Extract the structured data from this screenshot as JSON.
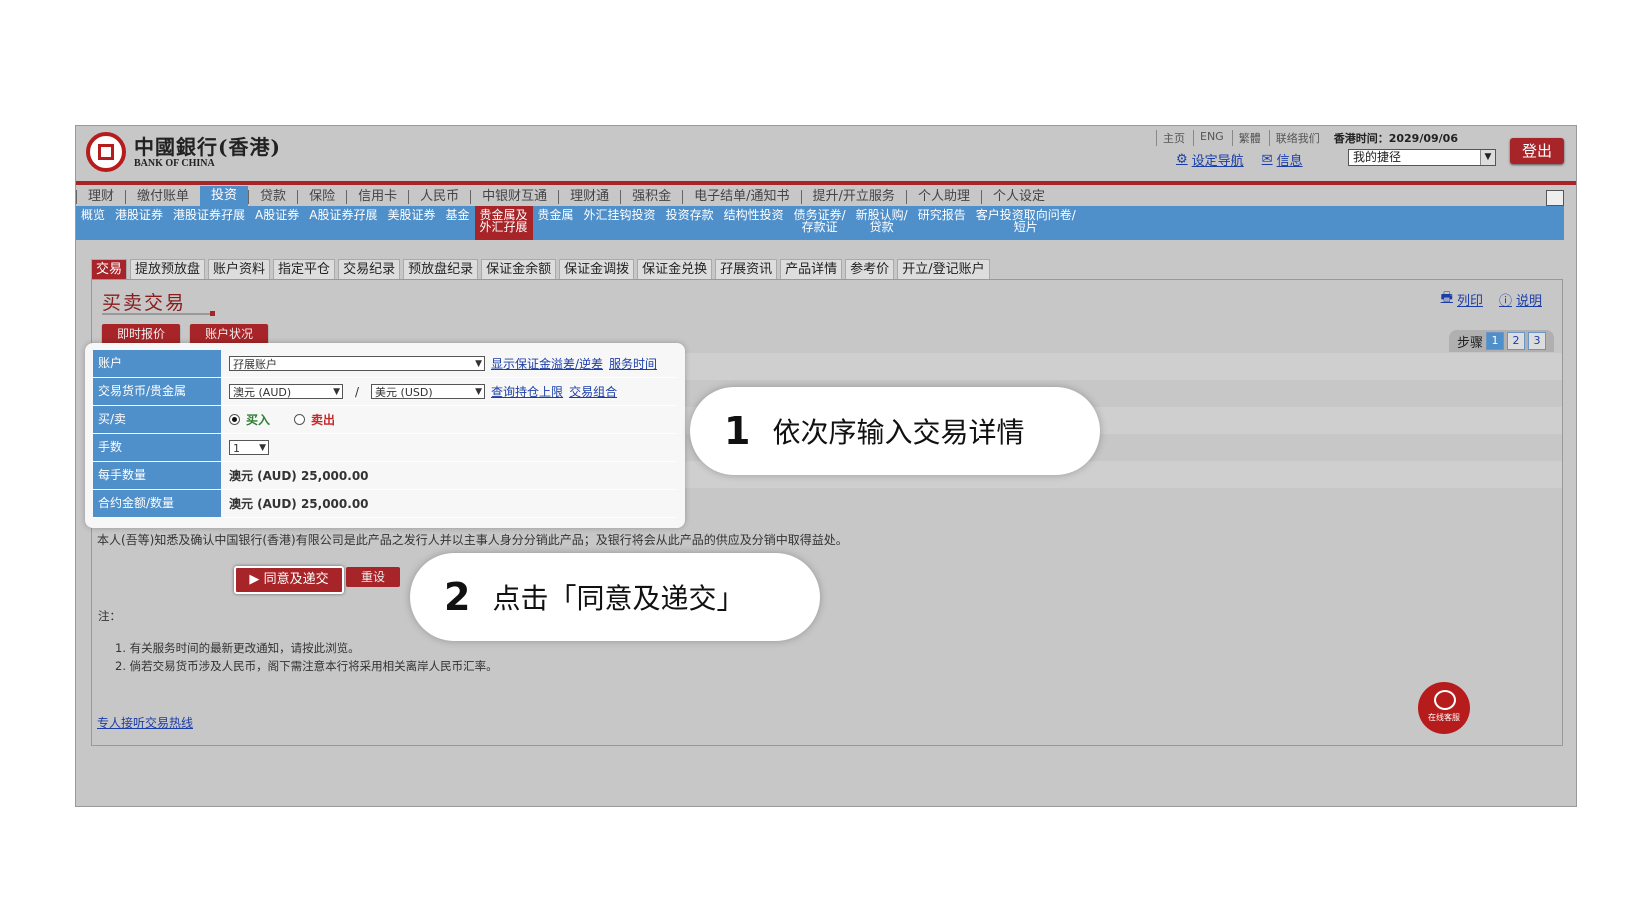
{
  "header": {
    "logo_cn": "中國銀行(香港)",
    "logo_en": "BANK OF CHINA",
    "top_links": [
      "主页",
      "ENG",
      "繁體",
      "联络我们"
    ],
    "time_label": "香港时间：2029/09/06",
    "settings_link": "设定导航",
    "message_link": "信息",
    "shortcut_value": "我的捷径",
    "logout": "登出"
  },
  "nav1": [
    "理财",
    "缴付账单",
    "投资",
    "贷款",
    "保险",
    "信用卡",
    "人民币",
    "中银财互通",
    "理财通",
    "强积金",
    "电子结单/通知书",
    "提升/开立服务",
    "个人助理",
    "个人设定"
  ],
  "nav2": [
    "概览",
    "港股证券",
    "港股证券孖展",
    "A股证券",
    "A股证券孖展",
    "美股证券",
    "基金",
    "贵金属及\n外汇孖展",
    "贵金属",
    "外汇挂钩投资",
    "投资存款",
    "结构性投资",
    "债务证券/\n存款证",
    "新股认购/\n贷款",
    "研究报告",
    "客户投资取向问卷/\n短片"
  ],
  "tabs": [
    "交易",
    "提放预放盘",
    "账户资料",
    "指定平仓",
    "交易纪录",
    "预放盘纪录",
    "保证金余额",
    "保证金调拨",
    "保证金兑换",
    "孖展资讯",
    "产品详情",
    "参考价",
    "开立/登记账户"
  ],
  "page": {
    "title": "买卖交易",
    "print": "列印",
    "help": "说明",
    "quote_btn": "即时报价",
    "account_btn": "账户状况",
    "steps_label": "步骤",
    "steps": [
      "1",
      "2",
      "3"
    ]
  },
  "form": {
    "account_label": "账户",
    "account_value": "孖展账户",
    "show_margin_link": "显示保证金溢差/逆差",
    "service_time_link": "服务时间",
    "currency_label": "交易货币/贵金属",
    "currency_from": "澳元 (AUD)",
    "slash": "/",
    "currency_to": "美元 (USD)",
    "position_limit_link": "查询持仓上限",
    "portfolio_link": "交易组合",
    "buysell_label": "买/卖",
    "buy": "买入",
    "sell": "卖出",
    "lots_label": "手数",
    "lots_value": "1",
    "lot_qty_label": "每手数量",
    "lot_qty_value": "澳元 (AUD) 25,000.00",
    "contract_label": "合约金额/数量",
    "contract_value": "澳元 (AUD) 25,000.00"
  },
  "disclaimer": "本人(吾等)知悉及确认中国银行(香港)有限公司是此产品之发行人并以主事人身分分销此产品；及银行将会从此产品的供应及分销中取得益处。",
  "buttons": {
    "agree": "同意及递交",
    "reset": "重设"
  },
  "notes": {
    "title": "注：",
    "items": [
      "1.  有关服务时间的最新更改通知，请按此浏览。",
      "2.  倘若交易货币涉及人民币，阁下需注意本行将采用相关离岸人民币汇率。"
    ]
  },
  "hotline": "专人接听交易热线",
  "chat": "在线客服",
  "callouts": [
    {
      "num": "1",
      "text": "依次序输入交易详情"
    },
    {
      "num": "2",
      "text": "点击「同意及递交」"
    }
  ]
}
